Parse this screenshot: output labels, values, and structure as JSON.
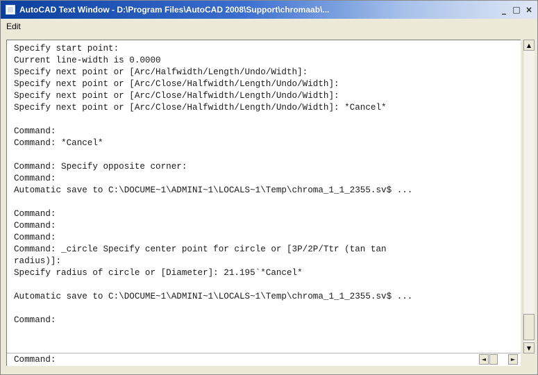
{
  "window": {
    "title": "AutoCAD Text Window - D:\\Program Files\\AutoCAD 2008\\Support\\chromaab\\...",
    "controls": {
      "minimize": "_",
      "maximize": "□",
      "close": "×"
    }
  },
  "menu": {
    "items": [
      "Edit"
    ]
  },
  "history": [
    "Specify start point:",
    "Current line-width is 0.0000",
    "Specify next point or [Arc/Halfwidth/Length/Undo/Width]:",
    "Specify next point or [Arc/Close/Halfwidth/Length/Undo/Width]:",
    "Specify next point or [Arc/Close/Halfwidth/Length/Undo/Width]:",
    "Specify next point or [Arc/Close/Halfwidth/Length/Undo/Width]: *Cancel*",
    "",
    "Command:",
    "Command: *Cancel*",
    "",
    "Command: Specify opposite corner:",
    "Command:",
    "Automatic save to C:\\DOCUME~1\\ADMINI~1\\LOCALS~1\\Temp\\chroma_1_1_2355.sv$ ...",
    "",
    "Command:",
    "Command:",
    "Command:",
    "Command: _circle Specify center point for circle or [3P/2P/Ttr (tan tan",
    "radius)]:",
    "Specify radius of circle or [Diameter]: 21.195`*Cancel*",
    "",
    "Automatic save to C:\\DOCUME~1\\ADMINI~1\\LOCALS~1\\Temp\\chroma_1_1_2355.sv$ ...",
    "",
    "Command:"
  ],
  "command_line": "Command:",
  "scroll": {
    "up": "▲",
    "down": "▼",
    "left": "◄",
    "right": "►"
  }
}
